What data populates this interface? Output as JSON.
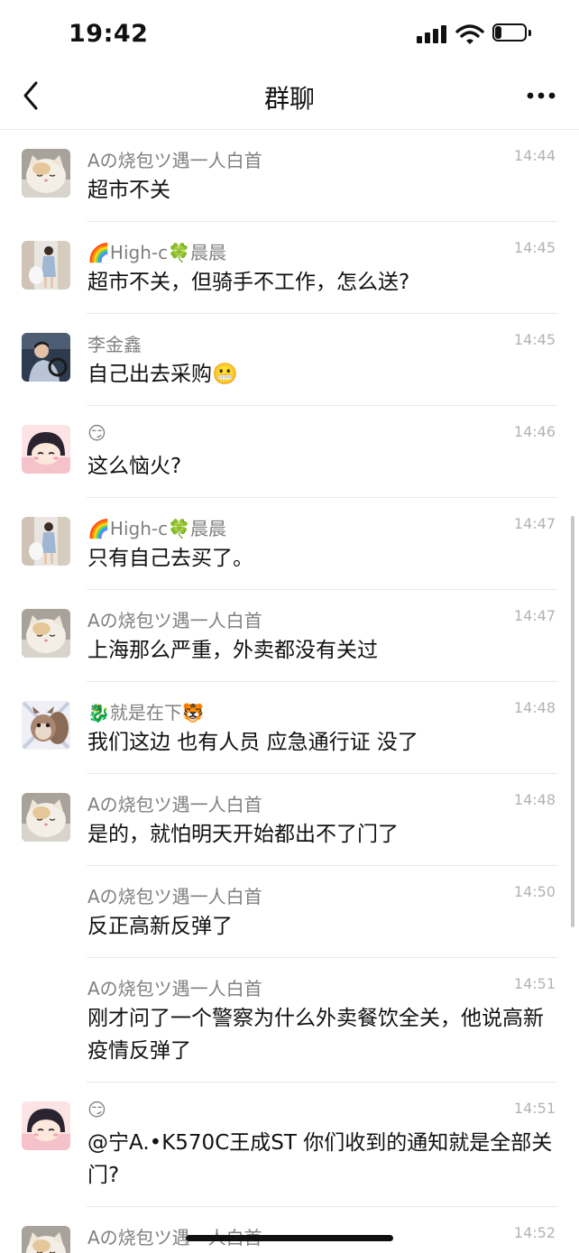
{
  "status_bar": {
    "time": "19:42",
    "battery_level": 0.22
  },
  "nav": {
    "title": "群聊"
  },
  "messages": [
    {
      "sender": "Aの烧包ツ遇一人白首",
      "time": "14:44",
      "text": "超市不关",
      "avatar": "cat"
    },
    {
      "sender": "🌈High-c🍀晨晨",
      "time": "14:45",
      "text": "超市不关，但骑手不工作，怎么送?",
      "avatar": "girl-photo"
    },
    {
      "sender": "李金鑫",
      "time": "14:45",
      "text": "自己出去采购😬",
      "avatar": "driver-photo"
    },
    {
      "sender": "😏",
      "time": "14:46",
      "text": "这么恼火?",
      "avatar": "cartoon-girl"
    },
    {
      "sender": "🌈High-c🍀晨晨",
      "time": "14:47",
      "text": "只有自己去买了。",
      "avatar": "girl-photo"
    },
    {
      "sender": "Aの烧包ツ遇一人白首",
      "time": "14:47",
      "text": "上海那么严重，外卖都没有关过",
      "avatar": "cat"
    },
    {
      "sender": "🐉就是在下🐯",
      "time": "14:48",
      "text": "我们这边 也有人员 应急通行证 没了",
      "avatar": "squirrel"
    },
    {
      "sender": "Aの烧包ツ遇一人白首",
      "time": "14:48",
      "text": "是的，就怕明天开始都出不了门了",
      "avatar": "cat"
    },
    {
      "sender": "Aの烧包ツ遇一人白首",
      "time": "14:50",
      "text": "反正高新反弹了",
      "avatar": "none"
    },
    {
      "sender": "Aの烧包ツ遇一人白首",
      "time": "14:51",
      "text": "刚才问了一个警察为什么外卖餐饮全关，他说高新疫情反弹了",
      "avatar": "none"
    },
    {
      "sender": "😏",
      "time": "14:51",
      "text": "@宁A.•K570C王成ST 你们收到的通知就是全部关门?",
      "avatar": "cartoon-girl"
    },
    {
      "sender": "Aの烧包ツ遇一人白首",
      "time": "14:52",
      "text": "",
      "avatar": "cat"
    }
  ]
}
